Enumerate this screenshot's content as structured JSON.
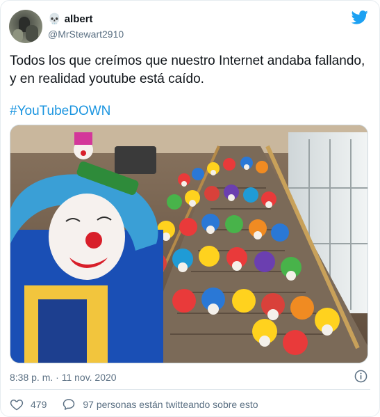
{
  "author": {
    "emoji": "💀",
    "display_name": "albert",
    "handle": "@MrStewart2910",
    "avatar_icon": "user-avatar"
  },
  "tweet": {
    "text": "Todos los que creímos que nuestro Internet andaba fallando, y en realidad youtube está caído.",
    "hashtag": "#YouTubeDOWN",
    "media_description_icon": "photo"
  },
  "meta": {
    "timestamp": "8:38 p. m. · 11 nov. 2020"
  },
  "actions": {
    "likes": "479",
    "conversation": "97 personas están twitteando sobre esto"
  },
  "colors": {
    "brand": "#1da1f2",
    "hashtag": "#1b95e0",
    "muted": "#5b7083"
  }
}
